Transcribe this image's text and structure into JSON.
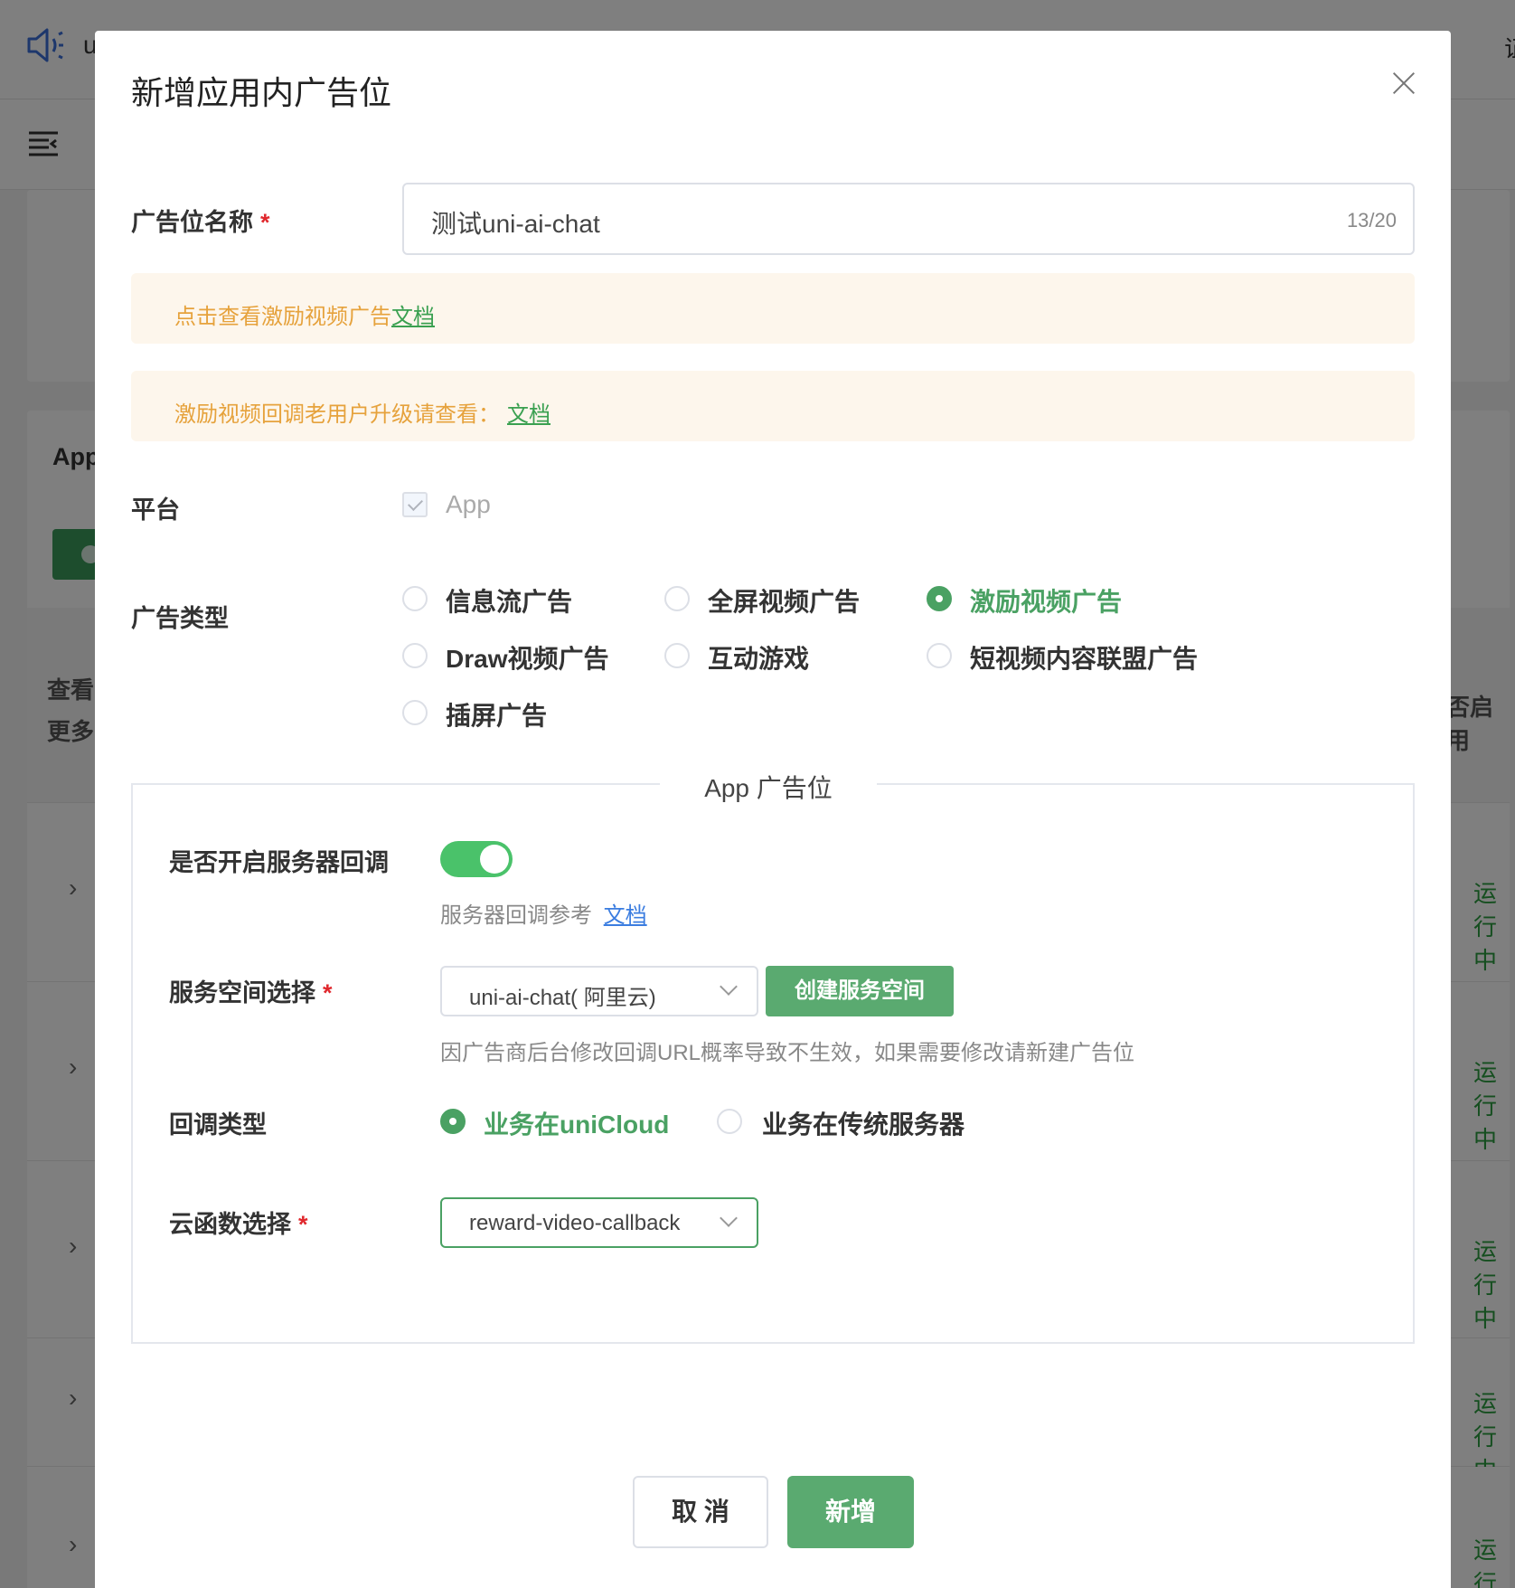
{
  "background": {
    "logo_text": "u",
    "top_right": "证",
    "card_title": "App",
    "table_head_left": [
      "查看",
      "更多"
    ],
    "table_head_right": "否启用",
    "row_status": "运行中"
  },
  "modal": {
    "title": "新增应用内广告位",
    "name_field": {
      "label": "广告位名称",
      "required_mark": "*",
      "value": "测试uni-ai-chat",
      "counter": "13/20"
    },
    "alert1": {
      "text": "点击查看激励视频广告",
      "link": "文档"
    },
    "alert2": {
      "text": "激励视频回调老用户升级请查看：",
      "link": "文档"
    },
    "platform": {
      "label": "平台",
      "option": "App",
      "checked": true
    },
    "ad_type": {
      "label": "广告类型",
      "options": [
        "信息流广告",
        "全屏视频广告",
        "激励视频广告",
        "Draw视频广告",
        "互动游戏",
        "短视频内容联盟广告",
        "插屏广告"
      ],
      "selected": "激励视频广告"
    },
    "app_section": {
      "legend": "App 广告位",
      "server_callback": {
        "label": "是否开启服务器回调",
        "enabled": true,
        "hint": "服务器回调参考",
        "hint_link": "文档"
      },
      "space": {
        "label": "服务空间选择",
        "required_mark": "*",
        "value": "uni-ai-chat( 阿里云)",
        "create_button": "创建服务空间",
        "hint": "因广告商后台修改回调URL概率导致不生效，如果需要修改请新建广告位"
      },
      "callback_type": {
        "label": "回调类型",
        "options": [
          "业务在uniCloud",
          "业务在传统服务器"
        ],
        "selected": "业务在uniCloud"
      },
      "cloud_function": {
        "label": "云函数选择",
        "required_mark": "*",
        "value": "reward-video-callback"
      }
    },
    "footer": {
      "cancel": "取 消",
      "submit": "新增"
    }
  },
  "colors": {
    "primary_green": "#4aa163",
    "warning_bg": "#fdf6ec",
    "warning_text": "#e6a23c",
    "link_blue": "#3b7de0",
    "required_red": "#e0282d"
  }
}
